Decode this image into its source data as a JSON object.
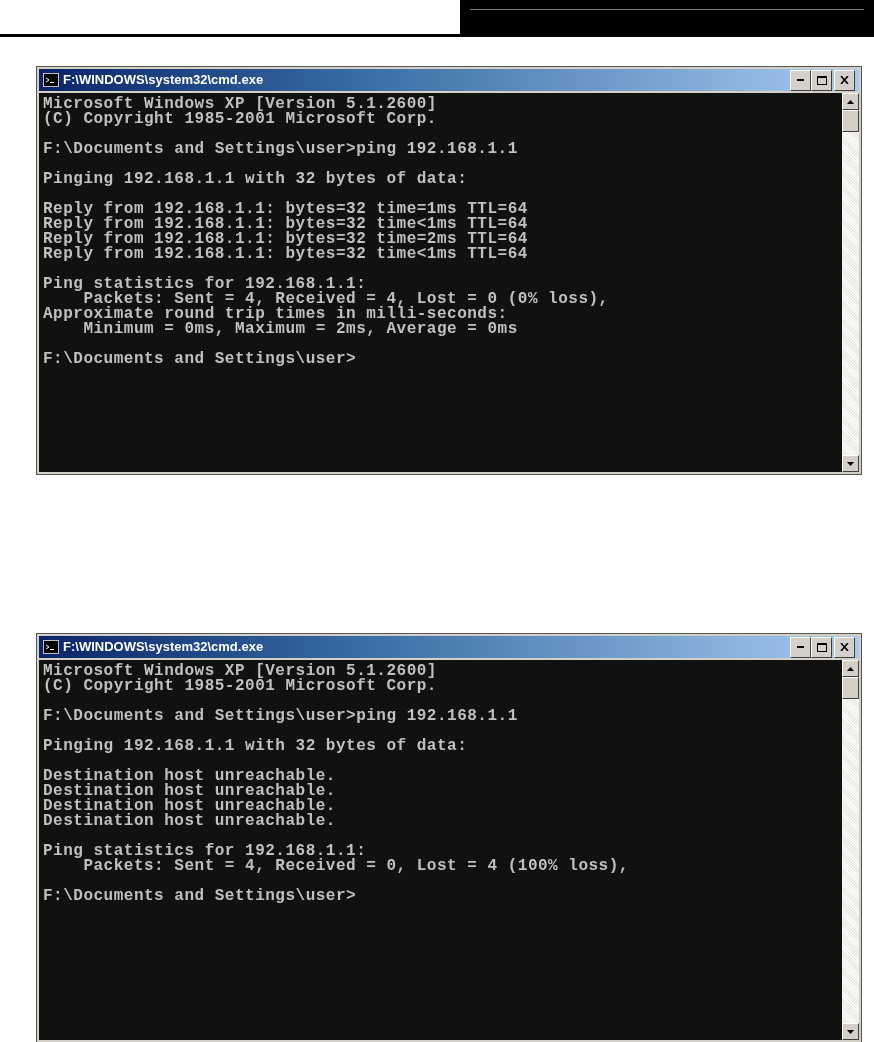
{
  "windows": [
    {
      "title": "F:\\WINDOWS\\system32\\cmd.exe",
      "blocks": [
        [
          "Microsoft Windows XP [Version 5.1.2600]",
          "(C) Copyright 1985-2001 Microsoft Corp."
        ],
        [
          "F:\\Documents and Settings\\user>ping 192.168.1.1"
        ],
        [
          "Pinging 192.168.1.1 with 32 bytes of data:"
        ],
        [
          "Reply from 192.168.1.1: bytes=32 time=1ms TTL=64",
          "Reply from 192.168.1.1: bytes=32 time<1ms TTL=64",
          "Reply from 192.168.1.1: bytes=32 time=2ms TTL=64",
          "Reply from 192.168.1.1: bytes=32 time<1ms TTL=64"
        ],
        [
          "Ping statistics for 192.168.1.1:",
          "    Packets: Sent = 4, Received = 4, Lost = 0 (0% loss),",
          "Approximate round trip times in milli-seconds:",
          "    Minimum = 0ms, Maximum = 2ms, Average = 0ms"
        ],
        [
          "F:\\Documents and Settings\\user>"
        ]
      ]
    },
    {
      "title": "F:\\WINDOWS\\system32\\cmd.exe",
      "blocks": [
        [
          "Microsoft Windows XP [Version 5.1.2600]",
          "(C) Copyright 1985-2001 Microsoft Corp."
        ],
        [
          "F:\\Documents and Settings\\user>ping 192.168.1.1"
        ],
        [
          "Pinging 192.168.1.1 with 32 bytes of data:"
        ],
        [
          "Destination host unreachable.",
          "Destination host unreachable.",
          "Destination host unreachable.",
          "Destination host unreachable."
        ],
        [
          "Ping statistics for 192.168.1.1:",
          "    Packets: Sent = 4, Received = 0, Lost = 4 (100% loss),"
        ],
        [
          "F:\\Documents and Settings\\user>"
        ]
      ]
    }
  ]
}
